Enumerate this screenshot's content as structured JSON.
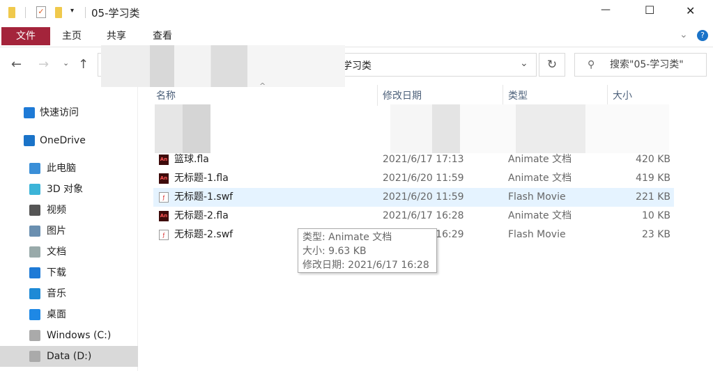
{
  "window": {
    "title": "05-学习类",
    "minimize": "—",
    "maximize": "☐",
    "close": "✕"
  },
  "ribbon": {
    "tabs": [
      "文件",
      "主页",
      "共享",
      "查看"
    ],
    "file_color": "#a4243b"
  },
  "address": {
    "path_end": "学习类",
    "search_placeholder": "搜索\"05-学习类\""
  },
  "columns": [
    "名称",
    "修改日期",
    "类型",
    "大小"
  ],
  "sidebar": [
    {
      "label": "快速访问",
      "icon": "star-icon"
    },
    {
      "label": "OneDrive",
      "icon": "cloud-icon"
    },
    {
      "label": "此电脑",
      "icon": "computer-icon"
    },
    {
      "label": "3D 对象",
      "icon": "cube-icon"
    },
    {
      "label": "视频",
      "icon": "video-icon"
    },
    {
      "label": "图片",
      "icon": "picture-icon"
    },
    {
      "label": "文档",
      "icon": "document-icon"
    },
    {
      "label": "下载",
      "icon": "download-icon"
    },
    {
      "label": "音乐",
      "icon": "music-icon"
    },
    {
      "label": "桌面",
      "icon": "desktop-icon"
    },
    {
      "label": "Windows (C:)",
      "icon": "drive-icon"
    },
    {
      "label": "Data (D:)",
      "icon": "drive-icon"
    }
  ],
  "files": [
    {
      "name": "篮球.fla",
      "date": "2021/6/17 17:13",
      "type": "Animate 文档",
      "size": "420 KB",
      "kind": "fla"
    },
    {
      "name": "无标题-1.fla",
      "date": "2021/6/20 11:59",
      "type": "Animate 文档",
      "size": "419 KB",
      "kind": "fla"
    },
    {
      "name": "无标题-1.swf",
      "date": "2021/6/20 11:59",
      "type": "Flash Movie",
      "size": "221 KB",
      "kind": "swf",
      "selected": true
    },
    {
      "name": "无标题-2.fla",
      "date": "2021/6/17 16:28",
      "type": "Animate 文档",
      "size": "10 KB",
      "kind": "fla"
    },
    {
      "name": "无标题-2.swf",
      "date": "2021/6/17 16:29",
      "type": "Flash Movie",
      "size": "23 KB",
      "kind": "swf"
    }
  ],
  "tooltip": {
    "type": "类型: Animate 文档",
    "size": "大小: 9.63 KB",
    "modified": "修改日期: 2021/6/17 16:28"
  }
}
